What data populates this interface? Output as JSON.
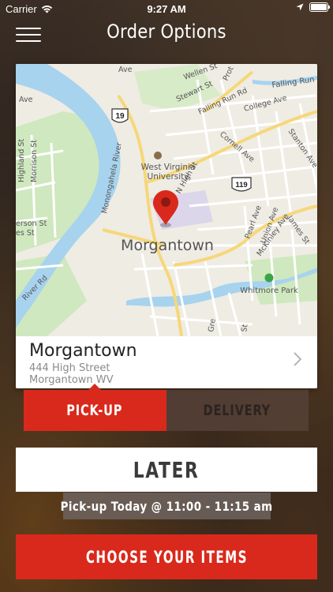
{
  "status_bar": {
    "carrier": "Carrier",
    "time": "9:27 AM",
    "icons": [
      "wifi-icon",
      "location-arrow-icon",
      "battery-icon"
    ]
  },
  "nav": {
    "title": "Order Options",
    "menu_icon": "hamburger-menu-icon"
  },
  "map": {
    "city_label": "Morgantown",
    "university_label_line1": "West Virginia",
    "university_label_line2": "University",
    "park_label": "Whitmore Park",
    "river_label": "Monongahela River",
    "route_19": "19",
    "route_119": "119",
    "streets": {
      "ave_top": "Ave",
      "wellen": "Wellen St",
      "prot": "Prot",
      "falling_run_upper": "Falling Run",
      "stewart": "Stewart St",
      "falling_run_rd": "Falling Run Rd",
      "college": "College Ave",
      "stanton": "Stanton Ave",
      "ave_left": "Ave",
      "cornell": "Cornell Ave",
      "highland": "Highland St",
      "morrison": "Morrison St",
      "n_high": "N High St",
      "pearl": "Pearl Ave",
      "union": "Union Ave",
      "mckinley": "McKinley Ave",
      "james": "James St",
      "erson": "erson St",
      "es": "es St",
      "river_rd": "River Rd",
      "st_bottom": "St",
      "gre": "Gre"
    }
  },
  "location": {
    "name": "Morgantown",
    "address_line1": "444 High Street",
    "address_line2": "Morgantown WV"
  },
  "toggle": {
    "pickup_label": "PICK-UP",
    "delivery_label": "DELIVERY",
    "selected": "PICK-UP"
  },
  "timing": {
    "label": "LATER",
    "info": "Pick-up Today @ 11:00 - 11:15 am"
  },
  "cta": {
    "label": "CHOOSE YOUR ITEMS"
  },
  "colors": {
    "accent": "#d9291c",
    "water": "#a7d3ee",
    "park": "#c7e6b4",
    "road_major": "#f6d77a",
    "pin": "#d9291c"
  }
}
